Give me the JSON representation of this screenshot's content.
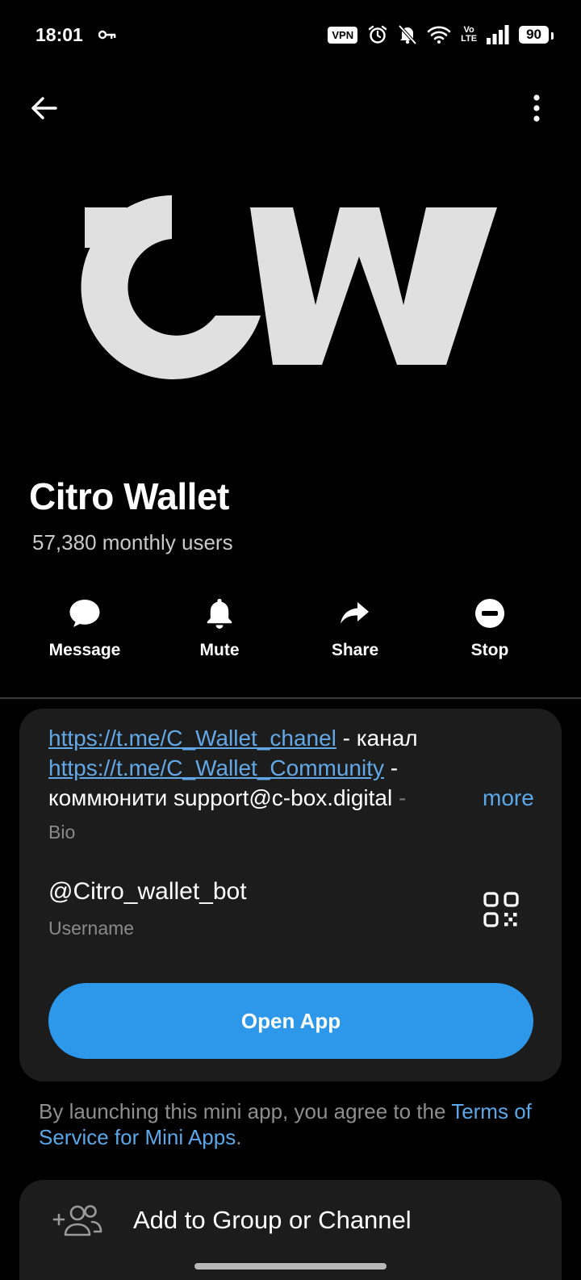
{
  "status_bar": {
    "time": "18:01",
    "vpn": "VPN",
    "volte_top": "Vo",
    "volte_bottom": "LTE",
    "battery": "90"
  },
  "profile": {
    "name": "Citro Wallet",
    "monthly_users": "57,380 monthly users"
  },
  "actions": [
    {
      "label": "Message",
      "icon": "chat-bubble-icon"
    },
    {
      "label": "Mute",
      "icon": "bell-icon"
    },
    {
      "label": "Share",
      "icon": "share-arrow-icon"
    },
    {
      "label": "Stop",
      "icon": "stop-circle-icon"
    }
  ],
  "bio": {
    "link1": "https://t.me/C_Wallet_chanel",
    "link1_suffix": " - канал",
    "link2": "https://t.me/C_Wallet_Community",
    "link2_suffix": " -",
    "line3": "коммюнити support@c-box.digital",
    "line3_fade": " - ",
    "more": "more",
    "caption": "Bio"
  },
  "username": {
    "value": "@Citro_wallet_bot",
    "caption": "Username"
  },
  "open_app": "Open App",
  "terms": {
    "prefix": "By launching this mini app, you agree to the ",
    "link": "Terms of Service for Mini Apps",
    "suffix": "."
  },
  "add_to_group": "Add to Group or Channel",
  "colors": {
    "accent": "#2d97ea",
    "link": "#62a7e6",
    "card": "#1c1c1c",
    "logo": "#e0e0e0"
  }
}
